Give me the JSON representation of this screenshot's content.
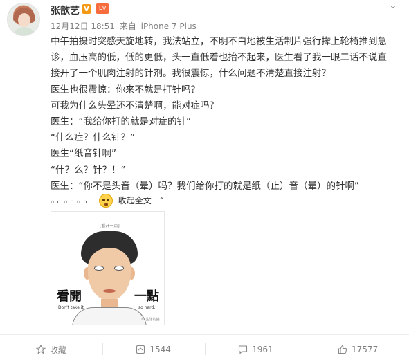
{
  "post": {
    "author": "张歆艺",
    "verified_mark": "V",
    "level_badge": "Lv",
    "date": "12月12日 18:51",
    "source_prefix": "来自",
    "source": "iPhone 7 Plus",
    "lines": [
      "中午拍摄时突感天旋地转，我法站立，不明不白地被生活制片强行撵上轮椅推到急诊，血压高的低，低的更低，头一直低着也抬不起来，医生看了我一眼二话不说直接开了一个肌肉注射的针剂。我很震惊，什么问题不清楚直接注射？",
      "医生也很震惊：你来不就是打针吗？",
      "可我为什么头晕还不清楚啊，能对症吗？",
      "医生：“我给你打的就是对症的针”",
      "“什么症？什么针？”",
      "医生“纸音针啊”",
      "“什？么？针？！”",
      "医生：“你不是头音（晕）吗？我们给你打的就是纸（止）音（晕）的针啊”"
    ],
    "ellipsis": "。。。。。。",
    "collapse_label": "收起全文",
    "collapse_arrow": "^"
  },
  "image": {
    "caption_top": "[看开一点]",
    "left_text": "看開",
    "right_text": "一點",
    "left_sub": "Don't take it",
    "right_sub": "so hard.",
    "signature": "© 生活的猫"
  },
  "actions": {
    "favorite_label": "收藏",
    "repost_count": "1544",
    "comment_count": "1961",
    "like_count": "17577"
  },
  "icons": {
    "favorite": "star-outline-icon",
    "repost": "repost-icon",
    "comment": "comment-icon",
    "like": "thumbs-up-icon",
    "menu": "chevron-down-icon"
  },
  "colors": {
    "verified": "#f29a13",
    "level": "#f66c3d",
    "meta": "#808080"
  }
}
